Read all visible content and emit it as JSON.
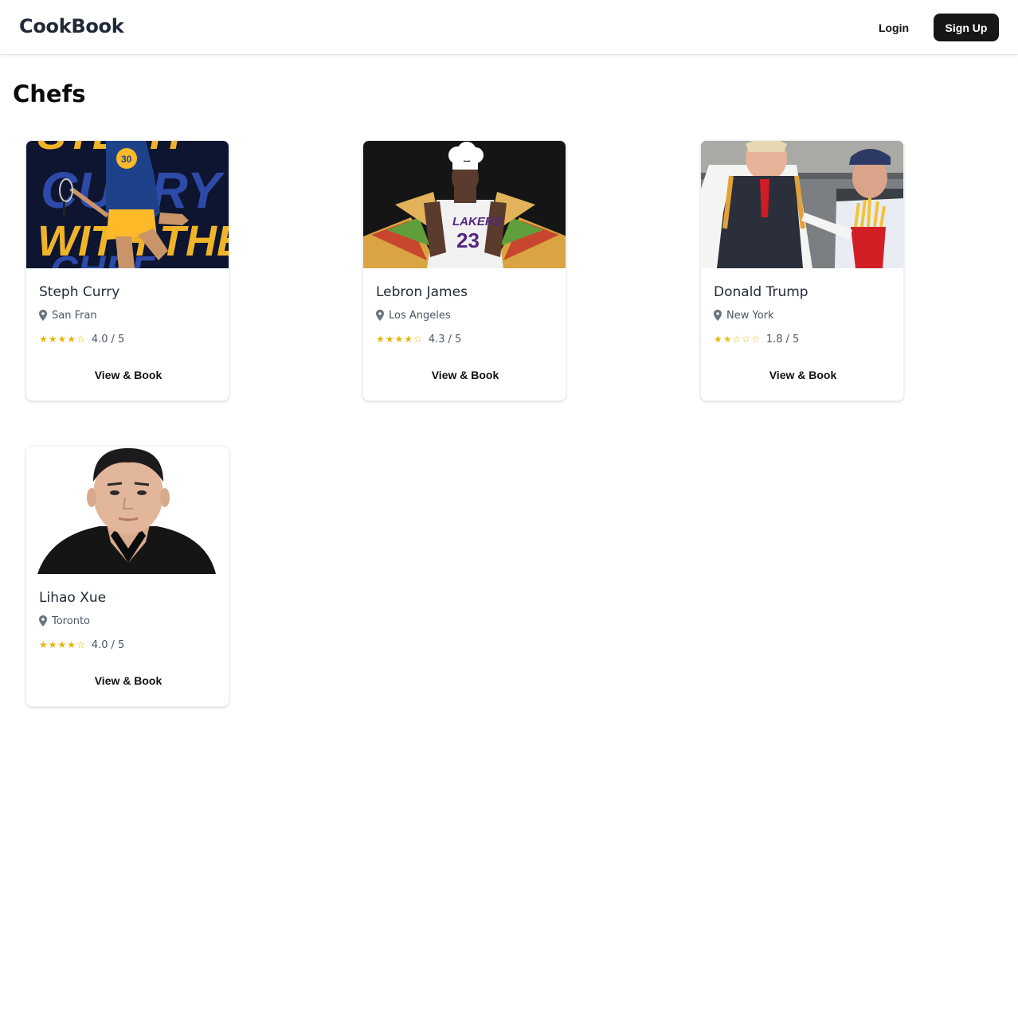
{
  "header": {
    "brand": "CookBook",
    "login_label": "Login",
    "signup_label": "Sign Up"
  },
  "page": {
    "title": "Chefs"
  },
  "chefs": [
    {
      "name": "Steph Curry",
      "location": "San Fran",
      "rating": 4.0,
      "rating_label": "4.0",
      "rating_max": "/ 5",
      "button": "View & Book",
      "photo_text": [
        "CURRY",
        "WITH THE"
      ]
    },
    {
      "name": "Lebron James",
      "location": "Los Angeles",
      "rating": 4.3,
      "rating_label": "4.3",
      "rating_max": "/ 5",
      "button": "View & Book",
      "photo_text": [
        "LAKERS",
        "23"
      ]
    },
    {
      "name": "Donald Trump",
      "location": "New York",
      "rating": 1.8,
      "rating_label": "1.8",
      "rating_max": "/ 5",
      "button": "View & Book",
      "photo_text": []
    },
    {
      "name": "Lihao Xue",
      "location": "Toronto",
      "rating": 4.0,
      "rating_label": "4.0",
      "rating_max": "/ 5",
      "button": "View & Book",
      "photo_text": []
    }
  ],
  "colors": {
    "star": "#eab308",
    "primary_button": "#171717",
    "text_muted": "#4b5563"
  },
  "icons": {
    "location": "map-pin-icon",
    "star": "star-icon"
  }
}
